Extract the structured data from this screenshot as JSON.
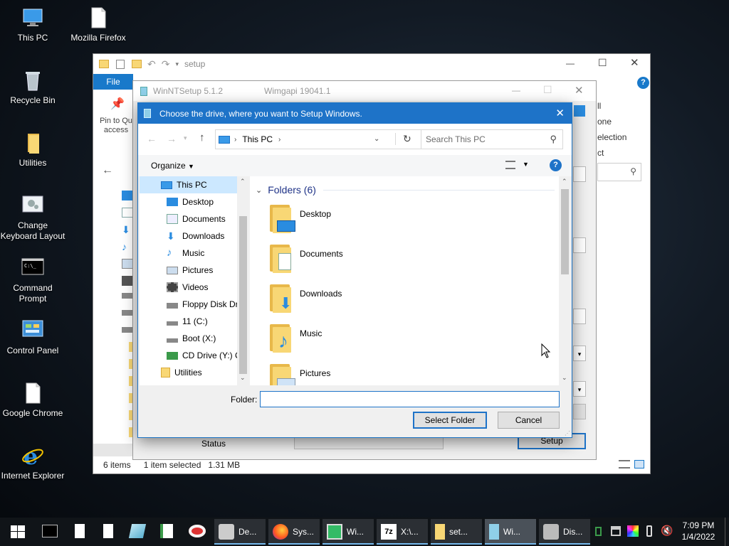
{
  "desktop": {
    "icons": [
      {
        "label": "This PC"
      },
      {
        "label": "Mozilla Firefox"
      },
      {
        "label": "Recycle Bin"
      },
      {
        "label": "Utilities"
      },
      {
        "label": "Change Keyboard Layout"
      },
      {
        "label": "Command Prompt"
      },
      {
        "label": "Control Panel"
      },
      {
        "label": "Google Chrome"
      },
      {
        "label": "Internet Explorer"
      }
    ]
  },
  "explorer": {
    "path": "setup",
    "file_tab": "File",
    "pin_label": "Pin to Qu access",
    "ribbon_right": [
      "ll",
      "one",
      "election",
      "ct"
    ],
    "status_items": "6 items",
    "status_selected": "1 item selected",
    "status_size": "1.31 MB"
  },
  "winntsetup": {
    "title": "WinNTSetup 5.1.2",
    "wimgapi": "Wimgapi 19041.1",
    "status_label": "Status",
    "setup_button": "Setup"
  },
  "dialog": {
    "title": "Choose the drive, where you want to Setup Windows.",
    "address": "This PC",
    "search_placeholder": "Search This PC",
    "organize": "Organize",
    "tree": [
      {
        "label": "This PC",
        "icon": "pc-icon"
      },
      {
        "label": "Desktop",
        "icon": "desktop-icon"
      },
      {
        "label": "Documents",
        "icon": "documents-icon"
      },
      {
        "label": "Downloads",
        "icon": "downloads-icon"
      },
      {
        "label": "Music",
        "icon": "music-icon"
      },
      {
        "label": "Pictures",
        "icon": "pictures-icon"
      },
      {
        "label": "Videos",
        "icon": "videos-icon"
      },
      {
        "label": "Floppy Disk Dri",
        "icon": "floppy-icon"
      },
      {
        "label": "11 (C:)",
        "icon": "drive-icon"
      },
      {
        "label": "Boot (X:)",
        "icon": "drive-icon"
      },
      {
        "label": "CD Drive (Y:) C",
        "icon": "cd-drive-icon"
      },
      {
        "label": "Utilities",
        "icon": "folder-icon"
      }
    ],
    "group_header": "Folders (6)",
    "folders": [
      {
        "label": "Desktop"
      },
      {
        "label": "Documents"
      },
      {
        "label": "Downloads"
      },
      {
        "label": "Music"
      },
      {
        "label": "Pictures"
      }
    ],
    "folder_label": "Folder:",
    "folder_value": "",
    "select_button": "Select Folder",
    "cancel_button": "Cancel"
  },
  "taskbar": {
    "tasks": [
      {
        "label": "De...",
        "icon": "device-icon"
      },
      {
        "label": "Sys...",
        "icon": "firefox-icon"
      },
      {
        "label": "Wi...",
        "icon": "monitor-icon"
      },
      {
        "label": "X:\\...",
        "icon": "7zip-icon"
      },
      {
        "label": "set...",
        "icon": "folder-icon"
      },
      {
        "label": "Wi...",
        "icon": "winntsetup-icon"
      },
      {
        "label": "Dis...",
        "icon": "disk-icon"
      }
    ],
    "time": "7:09 PM",
    "date": "1/4/2022"
  },
  "colors": {
    "accent": "#1e73c8",
    "folder_yellow": "#f8d775",
    "taskbar": "#101418"
  }
}
